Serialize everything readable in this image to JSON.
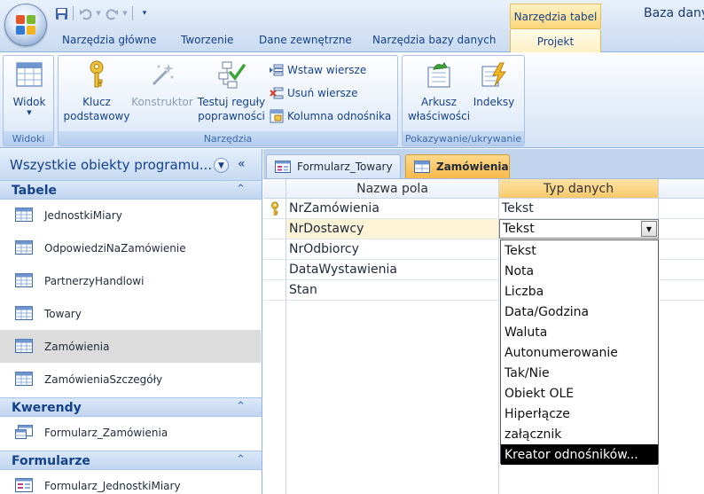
{
  "title_bar": {
    "context_tab": "Narzędzia tabel",
    "app_title": "Baza dany"
  },
  "ribbon_tabs": [
    "Narzędzia główne",
    "Tworzenie",
    "Dane zewnętrzne",
    "Narzędzia bazy danych",
    "Projekt"
  ],
  "ribbon": {
    "groups": {
      "widoki": "Widoki",
      "narzedzia": "Narzędzia",
      "pokazywanie": "Pokazywanie/ukrywanie"
    },
    "buttons": {
      "widok": "Widok",
      "klucz_line1": "Klucz",
      "klucz_line2": "podstawowy",
      "konstruktor": "Konstruktor",
      "testuj_line1": "Testuj reguły",
      "testuj_line2": "poprawności",
      "wstaw": "Wstaw wiersze",
      "usun": "Usuń wiersze",
      "kolumna": "Kolumna odnośnika",
      "arkusz_line1": "Arkusz",
      "arkusz_line2": "właściwości",
      "indeksy": "Indeksy"
    }
  },
  "nav_pane": {
    "title": "Wszystkie obiekty programu...",
    "sections": {
      "tabele": {
        "title": "Tabele",
        "items": [
          "JednostkiMiary",
          "OdpowiedziNaZamówienie",
          "PartnerzyHandlowi",
          "Towary",
          "Zamówienia",
          "ZamówieniaSzczegóły"
        ]
      },
      "kwerendy": {
        "title": "Kwerendy",
        "items": [
          "Formularz_Zamówienia"
        ]
      },
      "formularze": {
        "title": "Formularze",
        "items": [
          "Formularz_JednostkiMiary"
        ]
      }
    },
    "selected_item": "Zamówienia"
  },
  "doc_tabs": [
    "Formularz_Towary",
    "Zamówienia"
  ],
  "design_grid": {
    "headers": [
      "Nazwa pola",
      "Typ danych"
    ],
    "rows": [
      {
        "field": "NrZamówienia",
        "type": "Tekst",
        "primary_key": true
      },
      {
        "field": "NrDostawcy",
        "type": "Tekst"
      },
      {
        "field": "NrOdbiorcy",
        "type": ""
      },
      {
        "field": "DataWystawienia",
        "type": ""
      },
      {
        "field": "Stan",
        "type": ""
      }
    ]
  },
  "type_dropdown": {
    "selected_value": "Tekst",
    "options": [
      "Tekst",
      "Nota",
      "Liczba",
      "Data/Godzina",
      "Waluta",
      "Autonumerowanie",
      "Tak/Nie",
      "Obiekt OLE",
      "Hiperłącze",
      "załącznik",
      "Kreator odnośników..."
    ],
    "highlighted": "Kreator odnośników..."
  },
  "colors": {
    "accent_text": "#15428b",
    "context_tab": "#fbd77a",
    "active_doc_tab": "#f7b94a",
    "selection": "#dcdcdc"
  }
}
